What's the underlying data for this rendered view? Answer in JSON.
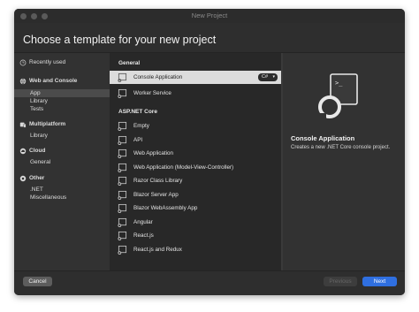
{
  "window": {
    "title": "New Project"
  },
  "header": {
    "title": "Choose a template for your new project"
  },
  "sidebar": {
    "recently_used": "Recently used",
    "web_and_console": {
      "label": "Web and Console",
      "items": [
        "App",
        "Library",
        "Tests"
      ]
    },
    "multiplatform": {
      "label": "Multiplatform",
      "items": [
        "Library"
      ]
    },
    "cloud": {
      "label": "Cloud",
      "items": [
        "General"
      ]
    },
    "other": {
      "label": "Other",
      "items": [
        ".NET",
        "Miscellaneous"
      ]
    }
  },
  "templates": {
    "general_heading": "General",
    "general": [
      {
        "label": "Console Application",
        "language": "C#"
      },
      {
        "label": "Worker Service"
      }
    ],
    "aspnet_heading": "ASP.NET Core",
    "aspnet": [
      {
        "label": "Empty"
      },
      {
        "label": "API"
      },
      {
        "label": "Web Application"
      },
      {
        "label": "Web Application (Model-View-Controller)"
      },
      {
        "label": "Razor Class Library"
      },
      {
        "label": "Blazor Server App"
      },
      {
        "label": "Blazor WebAssembly App"
      },
      {
        "label": "Angular"
      },
      {
        "label": "React.js"
      },
      {
        "label": "React.js and Redux"
      }
    ]
  },
  "detail": {
    "title": "Console Application",
    "description": "Creates a new .NET Core console project."
  },
  "footer": {
    "cancel": "Cancel",
    "previous": "Previous",
    "next": "Next"
  },
  "colors": {
    "accent": "#2f6fe0",
    "window_bg": "#323232",
    "list_bg": "#282828",
    "selection": "#dcdcdc"
  },
  "icons": {
    "recently_used": "clock-icon",
    "web_and_console": "globe-icon",
    "multiplatform": "devices-icon",
    "cloud": "cloud-icon",
    "other": "gear-icon",
    "template": "template-window-icon",
    "detail": "console-app-icon"
  }
}
